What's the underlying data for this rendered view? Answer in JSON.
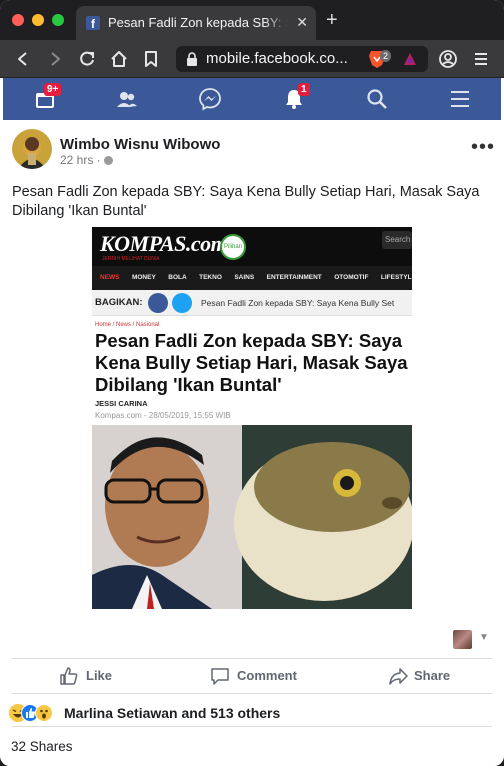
{
  "browser": {
    "tab_title": "Pesan Fadli Zon kepada SBY: Saya",
    "tab_favicon": "f",
    "tab_close": "✕",
    "new_tab": "+",
    "url": "mobile.facebook.co...",
    "brave_count": "2"
  },
  "fbnav": {
    "notifications_badge": "9+",
    "alerts_badge": "1"
  },
  "post": {
    "author": "Wimbo Wisnu Wibowo",
    "time": "22 hrs ·",
    "more": "•••",
    "text": "Pesan Fadli Zon kepada SBY: Saya Kena Bully Setiap Hari, Masak Saya Dibilang 'Ikan Buntal'"
  },
  "shared_image": {
    "logo": "KOMPAS.com",
    "tagline": "JERNIH MELIHAT DUNIA",
    "badge": "Pilihan",
    "search": "Search",
    "menu": [
      "NEWS",
      "MONEY",
      "BOLA",
      "TEKNO",
      "SAINS",
      "ENTERTAINMENT",
      "OTOMOTIF",
      "LIFESTYLE"
    ],
    "share_label": "BAGIKAN:",
    "share_title": "Pesan Fadli Zon kepada SBY: Saya Kena Bully Set",
    "breadcrumb": "Home / News / Nasional",
    "headline": "Pesan Fadli Zon kepada SBY: Saya Kena Bully Setiap Hari, Masak Saya Dibilang 'Ikan Buntal'",
    "byline": "JESSI CARINA",
    "date": "Kompas.com - 28/05/2019, 15:55 WIB"
  },
  "actions": {
    "like": "Like",
    "comment": "Comment",
    "share": "Share"
  },
  "reactions": {
    "summary": "Marlina Setiawan and 513 others",
    "shares": "32 Shares"
  },
  "colors": {
    "fb_blue": "#3b5998",
    "badge_red": "#e41e3f"
  }
}
